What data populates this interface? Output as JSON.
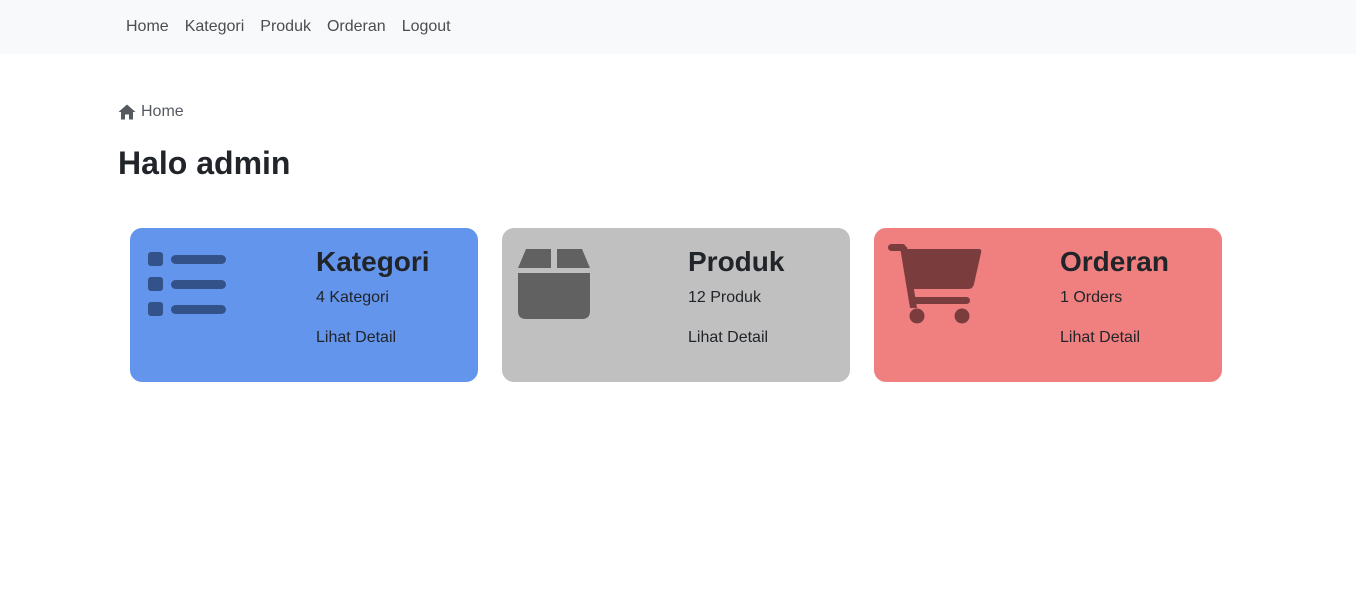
{
  "navbar": {
    "items": [
      {
        "label": "Home"
      },
      {
        "label": "Kategori"
      },
      {
        "label": "Produk"
      },
      {
        "label": "Orderan"
      },
      {
        "label": "Logout"
      }
    ]
  },
  "breadcrumb": {
    "icon": "home-icon",
    "label": "Home"
  },
  "page": {
    "title": "Halo admin"
  },
  "cards": [
    {
      "title": "Kategori",
      "count": "4 Kategori",
      "link": "Lihat Detail",
      "icon": "list-icon",
      "color": "#6495ed"
    },
    {
      "title": "Produk",
      "count": "12 Produk",
      "link": "Lihat Detail",
      "icon": "box-icon",
      "color": "#c0c0c0"
    },
    {
      "title": "Orderan",
      "count": "1 Orders",
      "link": "Lihat Detail",
      "icon": "cart-icon",
      "color": "#f08080"
    }
  ]
}
